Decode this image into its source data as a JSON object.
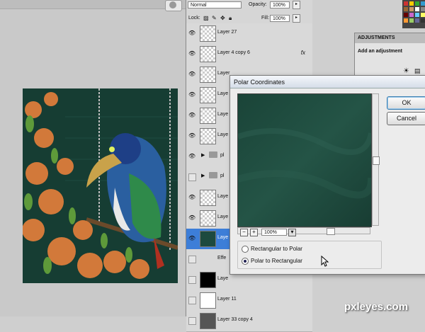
{
  "app": {
    "title_icon": "photoshop-app-icon"
  },
  "layers_panel": {
    "blend_mode": "Normal",
    "opacity_label": "Opacity:",
    "opacity_value": "100%",
    "lock_label": "Lock:",
    "fill_label": "Fill:",
    "fill_value": "100%",
    "fx_symbol": "fx",
    "layers": [
      {
        "name": "Layer 27",
        "visible": true
      },
      {
        "name": "Layer 4 copy 6",
        "visible": true
      },
      {
        "name": "Layer",
        "visible": true
      },
      {
        "name": "Laye",
        "visible": true
      },
      {
        "name": "Laye",
        "visible": true
      },
      {
        "name": "Laye",
        "visible": true
      },
      {
        "name": "pl",
        "visible": true
      },
      {
        "name": "pl",
        "visible": false
      },
      {
        "name": "Laye",
        "visible": true
      },
      {
        "name": "Laye",
        "visible": true
      },
      {
        "name": "Laye",
        "visible": true
      },
      {
        "name": "Effe",
        "visible": false
      },
      {
        "name": "Laye",
        "visible": false
      },
      {
        "name": "Layer 11",
        "visible": false
      },
      {
        "name": "Layer 33 copy 4",
        "visible": false
      }
    ]
  },
  "adjustments_panel": {
    "tab": "ADJUSTMENTS",
    "heading": "Add an adjustment"
  },
  "dialog": {
    "title": "Polar Coordinates",
    "ok_label": "OK",
    "cancel_label": "Cancel",
    "zoom_value": "100%",
    "zoom_out": "−",
    "zoom_in": "+",
    "options": [
      {
        "label": "Rectangular to Polar",
        "selected": false
      },
      {
        "label": "Polar to Rectangular",
        "selected": true
      }
    ]
  },
  "watermark": "pxleyes.com",
  "colors": {
    "preview": "#1d4a3f",
    "selection": "#3d7ed8",
    "artwork_background": "#163d33"
  }
}
